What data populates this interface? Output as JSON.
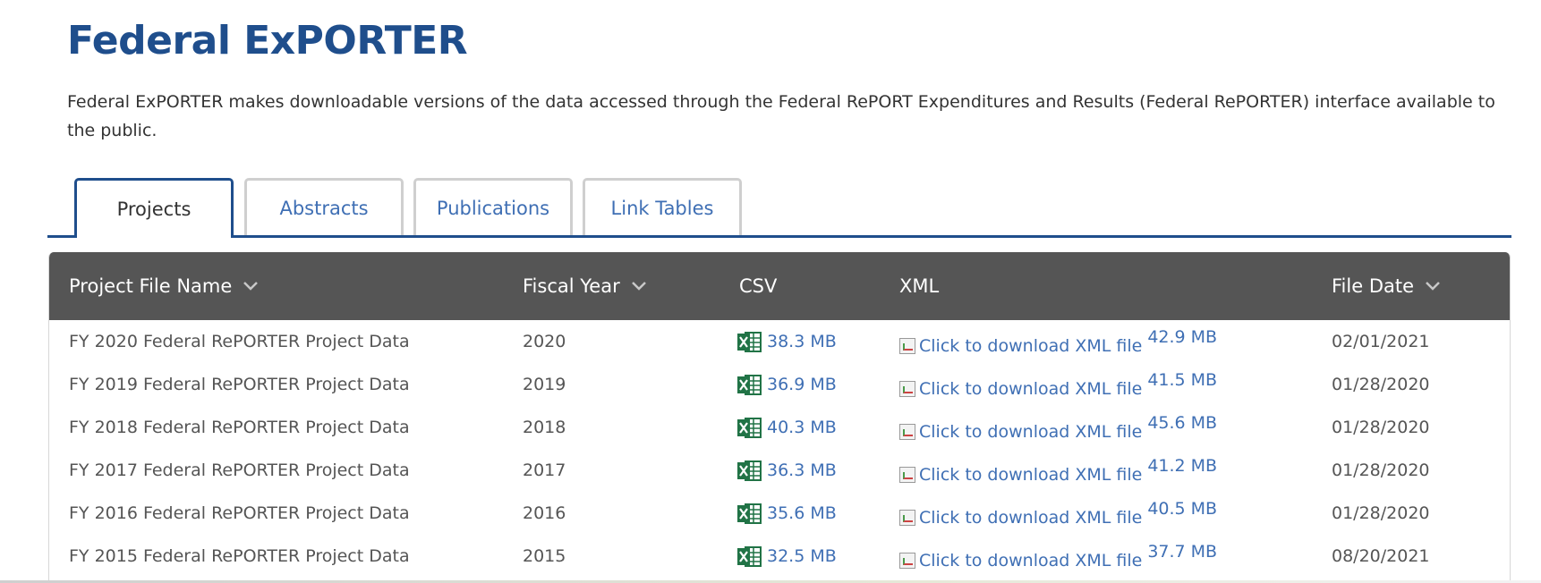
{
  "page": {
    "title": "Federal ExPORTER",
    "intro": "Federal ExPORTER makes downloadable versions of the data accessed through the Federal RePORT Expenditures and Results (Federal RePORTER) interface available to the public."
  },
  "tabs": [
    {
      "label": "Projects",
      "active": true
    },
    {
      "label": "Abstracts",
      "active": false
    },
    {
      "label": "Publications",
      "active": false
    },
    {
      "label": "Link Tables",
      "active": false
    }
  ],
  "table": {
    "headers": {
      "name": "Project File Name",
      "year": "Fiscal Year",
      "csv": "CSV",
      "xml": "XML",
      "date": "File Date"
    },
    "xml_alt": "Click to download XML file",
    "rows": [
      {
        "name": "FY 2020 Federal RePORTER Project Data",
        "year": "2020",
        "csv": "38.3 MB",
        "xml": "42.9 MB",
        "date": "02/01/2021"
      },
      {
        "name": "FY 2019 Federal RePORTER Project Data",
        "year": "2019",
        "csv": "36.9 MB",
        "xml": "41.5 MB",
        "date": "01/28/2020"
      },
      {
        "name": "FY 2018 Federal RePORTER Project Data",
        "year": "2018",
        "csv": "40.3 MB",
        "xml": "45.6 MB",
        "date": "01/28/2020"
      },
      {
        "name": "FY 2017 Federal RePORTER Project Data",
        "year": "2017",
        "csv": "36.3 MB",
        "xml": "41.2 MB",
        "date": "01/28/2020"
      },
      {
        "name": "FY 2016 Federal RePORTER Project Data",
        "year": "2016",
        "csv": "35.6 MB",
        "xml": "40.5 MB",
        "date": "01/28/2020"
      },
      {
        "name": "FY 2015 Federal RePORTER Project Data",
        "year": "2015",
        "csv": "32.5 MB",
        "xml": "37.7 MB",
        "date": "08/20/2021"
      }
    ]
  },
  "colors": {
    "brand_blue": "#1f4e8c",
    "link_blue": "#3f6fb4",
    "header_bg": "#555555",
    "excel_green": "#217346"
  }
}
